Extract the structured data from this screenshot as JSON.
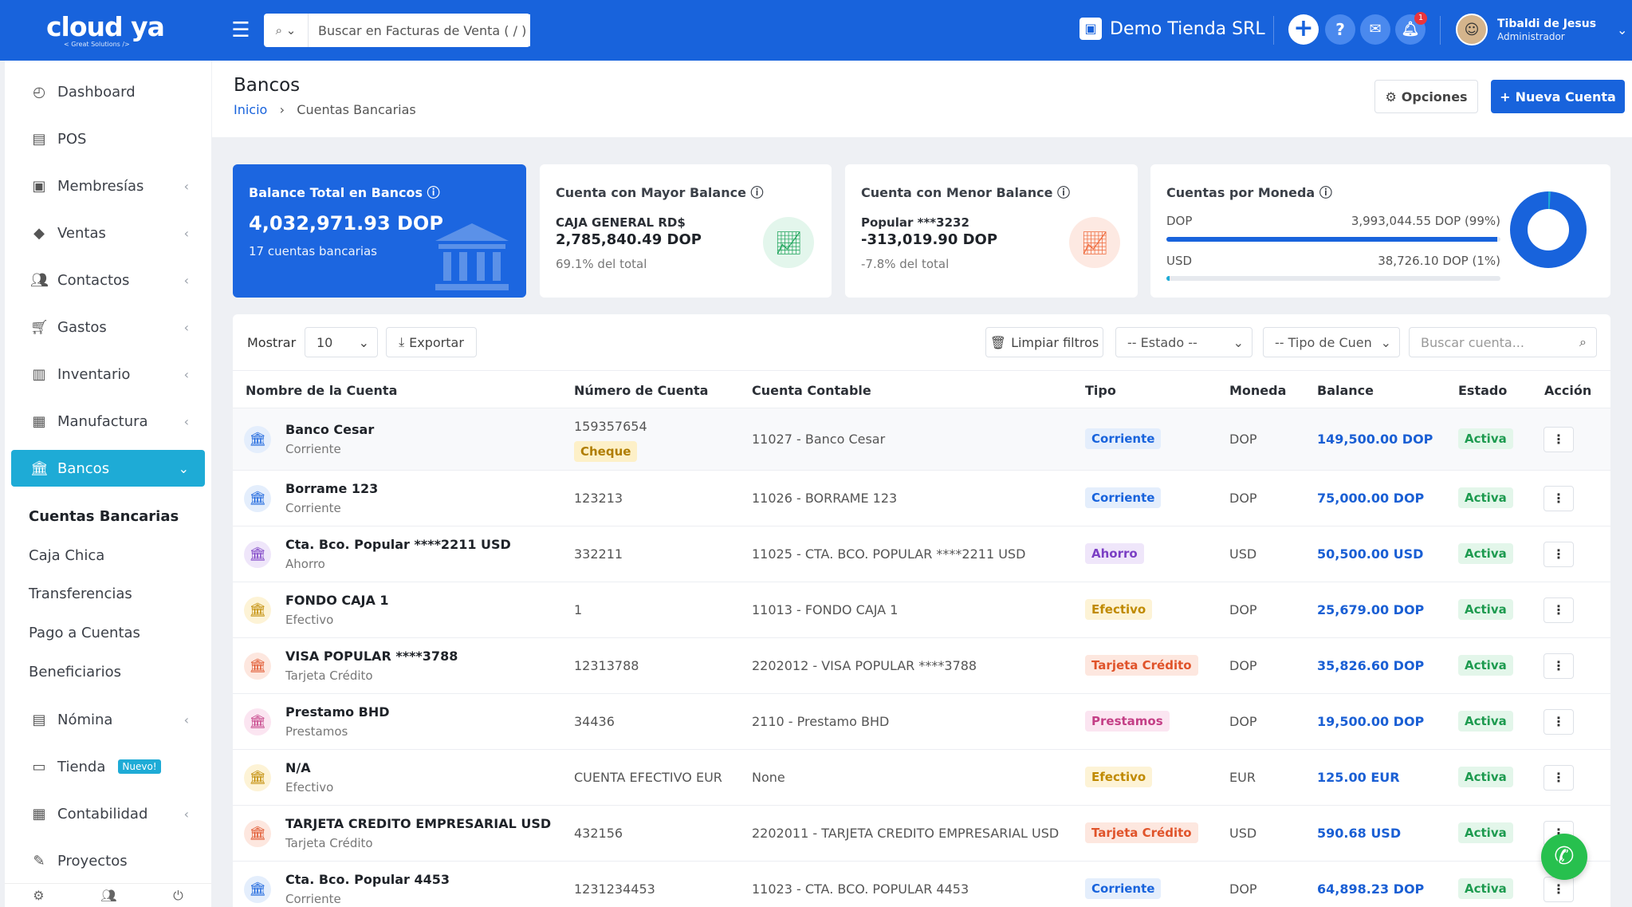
{
  "brand": {
    "name": "cloud ya",
    "tagline": "< Great Solutions />"
  },
  "header": {
    "search_prefix": "⌕ ⌄",
    "search_placeholder": "Buscar en Facturas de Venta ( / )",
    "store_name": "Demo Tienda SRL",
    "notifications_count": "1",
    "user_name": "Tibaldi de Jesus",
    "user_role": "Administrador"
  },
  "sidebar": {
    "items": [
      {
        "label": "Dashboard",
        "icon": "dashboard-icon"
      },
      {
        "label": "POS",
        "icon": "cash-register-icon"
      },
      {
        "label": "Membresías",
        "icon": "id-card-icon"
      },
      {
        "label": "Ventas",
        "icon": "tag-icon"
      },
      {
        "label": "Contactos",
        "icon": "users-icon"
      },
      {
        "label": "Gastos",
        "icon": "cart-icon"
      },
      {
        "label": "Inventario",
        "icon": "barcode-icon"
      },
      {
        "label": "Manufactura",
        "icon": "factory-icon"
      },
      {
        "label": "Bancos",
        "icon": "bank-icon"
      },
      {
        "label": "Nómina",
        "icon": "payroll-icon"
      },
      {
        "label": "Tienda",
        "icon": "store-icon",
        "badge": "Nuevo!"
      },
      {
        "label": "Contabilidad",
        "icon": "grid-icon"
      },
      {
        "label": "Proyectos",
        "icon": "tools-icon"
      }
    ],
    "bancos_sub": [
      "Cuentas Bancarias",
      "Caja Chica",
      "Transferencias",
      "Pago a Cuentas",
      "Beneficiarios"
    ]
  },
  "page": {
    "title": "Bancos",
    "breadcrumb_home": "Inicio",
    "breadcrumb_current": "Cuentas Bancarias",
    "options_label": "Opciones",
    "new_account_label": "Nueva Cuenta"
  },
  "cards": {
    "total": {
      "title": "Balance Total en Bancos",
      "value": "4,032,971.93 DOP",
      "sub": "17 cuentas bancarias"
    },
    "mayor": {
      "title": "Cuenta con Mayor Balance",
      "account": "CAJA GENERAL RD$",
      "value": "2,785,840.49 DOP",
      "pct": "69.1% del total"
    },
    "menor": {
      "title": "Cuenta con Menor Balance",
      "account": "Popular ***3232",
      "value": "-313,019.90 DOP",
      "pct": "-7.8% del total"
    },
    "moneda": {
      "title": "Cuentas por Moneda",
      "rows": [
        {
          "code": "DOP",
          "amount": "3,993,044.55 DOP (99%)",
          "share": 0.99,
          "color": "#1863dc"
        },
        {
          "code": "USD",
          "amount": "38,726.10 DOP (1%)",
          "share": 0.01,
          "color": "#1eabd6"
        }
      ]
    }
  },
  "toolbar": {
    "show_label": "Mostrar",
    "page_size": "10",
    "export_label": "Exportar",
    "clear_filters_label": "Limpiar filtros",
    "status_filter": "-- Estado --",
    "type_filter": "-- Tipo de Cuen",
    "search_placeholder": "Buscar cuenta..."
  },
  "table": {
    "columns": [
      "Nombre de la Cuenta",
      "Número de Cuenta",
      "Cuenta Contable",
      "Tipo",
      "Moneda",
      "Balance",
      "Estado",
      "Acción"
    ],
    "rows": [
      {
        "name": "Banco Cesar",
        "subtype": "Corriente",
        "number": "159357654",
        "extra": "Cheque",
        "ledger": "11027 - Banco Cesar",
        "type": "Corriente",
        "currency": "DOP",
        "balance": "149,500.00 DOP",
        "status": "Activa"
      },
      {
        "name": "Borrame 123",
        "subtype": "Corriente",
        "number": "123213",
        "ledger": "11026 - BORRAME 123",
        "type": "Corriente",
        "currency": "DOP",
        "balance": "75,000.00 DOP",
        "status": "Activa"
      },
      {
        "name": "Cta. Bco. Popular ****2211 USD",
        "subtype": "Ahorro",
        "number": "332211",
        "ledger": "11025 - CTA. BCO. POPULAR ****2211 USD",
        "type": "Ahorro",
        "currency": "USD",
        "balance": "50,500.00 USD",
        "status": "Activa"
      },
      {
        "name": "FONDO CAJA 1",
        "subtype": "Efectivo",
        "number": "1",
        "ledger": "11013 - FONDO CAJA 1",
        "type": "Efectivo",
        "currency": "DOP",
        "balance": "25,679.00 DOP",
        "status": "Activa"
      },
      {
        "name": "VISA POPULAR ****3788",
        "subtype": "Tarjeta Crédito",
        "number": "12313788",
        "ledger": "2202012 - VISA POPULAR ****3788",
        "type": "Tarjeta Crédito",
        "currency": "DOP",
        "balance": "35,826.60 DOP",
        "status": "Activa"
      },
      {
        "name": "Prestamo BHD",
        "subtype": "Prestamos",
        "number": "34436",
        "ledger": "2110 - Prestamo BHD",
        "type": "Prestamos",
        "currency": "DOP",
        "balance": "19,500.00 DOP",
        "status": "Activa"
      },
      {
        "name": "N/A",
        "subtype": "Efectivo",
        "number": "CUENTA EFECTIVO EUR",
        "ledger": "None",
        "type": "Efectivo",
        "currency": "EUR",
        "balance": "125.00 EUR",
        "status": "Activa"
      },
      {
        "name": "TARJETA CREDITO EMPRESARIAL USD",
        "subtype": "Tarjeta Crédito",
        "number": "432156",
        "ledger": "2202011 - TARJETA CREDITO EMPRESARIAL USD",
        "type": "Tarjeta Crédito",
        "currency": "USD",
        "balance": "590.68 USD",
        "status": "Activa"
      },
      {
        "name": "Cta. Bco. Popular 4453",
        "subtype": "Corriente",
        "number": "1231234453",
        "ledger": "11023 - CTA. BCO. POPULAR 4453",
        "type": "Corriente",
        "currency": "DOP",
        "balance": "64,898.23 DOP",
        "status": "Activa"
      }
    ]
  },
  "type_colors": {
    "Corriente": {
      "fg": "#1863dc",
      "bg": "#e4eefc"
    },
    "Ahorro": {
      "fg": "#7b3fc4",
      "bg": "#efe6fa"
    },
    "Efectivo": {
      "fg": "#c08a00",
      "bg": "#fdf3d6"
    },
    "Tarjeta Crédito": {
      "fg": "#e0532a",
      "bg": "#fde7df"
    },
    "Prestamos": {
      "fg": "#c43f86",
      "bg": "#fbe5f1"
    },
    "Cheque": {
      "fg": "#b07d00",
      "bg": "#fdf0c8"
    },
    "Activa": {
      "fg": "#1e9b50",
      "bg": "#e3f6ea"
    }
  }
}
